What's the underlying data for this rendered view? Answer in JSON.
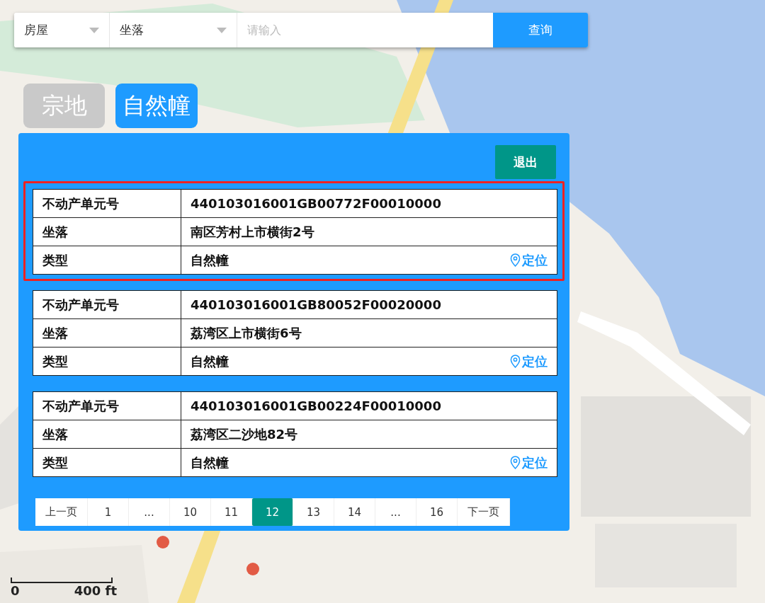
{
  "search": {
    "category": "房屋",
    "field": "坐落",
    "placeholder": "请输入",
    "button": "查询"
  },
  "tabs": [
    {
      "label": "宗地",
      "selected": false
    },
    {
      "label": "自然幢",
      "selected": true
    }
  ],
  "panel": {
    "exit_button": "退出",
    "records": [
      {
        "selected": true,
        "rows": [
          {
            "label": "不动产单元号",
            "value": "440103016001GB00772F00010000"
          },
          {
            "label": "坐落",
            "value": "南区芳村上市横街2号"
          },
          {
            "label": "类型",
            "value": "自然幢"
          }
        ],
        "locate": "定位"
      },
      {
        "selected": false,
        "rows": [
          {
            "label": "不动产单元号",
            "value": "440103016001GB80052F00020000"
          },
          {
            "label": "坐落",
            "value": "荔湾区上市横街6号"
          },
          {
            "label": "类型",
            "value": "自然幢"
          }
        ],
        "locate": "定位"
      },
      {
        "selected": false,
        "rows": [
          {
            "label": "不动产单元号",
            "value": "440103016001GB00224F00010000"
          },
          {
            "label": "坐落",
            "value": "荔湾区二沙地82号"
          },
          {
            "label": "类型",
            "value": "自然幢"
          }
        ],
        "locate": "定位"
      }
    ],
    "pagination": [
      {
        "label": "上一页",
        "selected": false
      },
      {
        "label": "1",
        "selected": false
      },
      {
        "label": "...",
        "selected": false
      },
      {
        "label": "10",
        "selected": false
      },
      {
        "label": "11",
        "selected": false
      },
      {
        "label": "12",
        "selected": true
      },
      {
        "label": "13",
        "selected": false
      },
      {
        "label": "14",
        "selected": false
      },
      {
        "label": "...",
        "selected": false
      },
      {
        "label": "16",
        "selected": false
      },
      {
        "label": "下一页",
        "selected": false
      }
    ]
  },
  "scale": {
    "start": "0",
    "end": "400 ft"
  }
}
